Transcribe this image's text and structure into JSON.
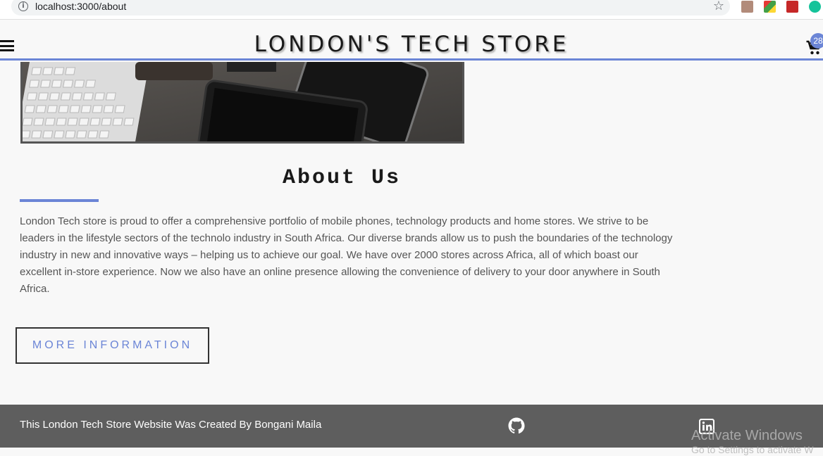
{
  "browser": {
    "url": "localhost:3000/about",
    "info_icon": "i"
  },
  "header": {
    "title": "LONDON'S TECH STORE",
    "cart_count": "28"
  },
  "about": {
    "title": "About Us",
    "body": "London Tech store is proud to offer a comprehensive portfolio of mobile phones, technology products and home stores. We strive to be leaders in the lifestyle sectors of the technolo industry in South Africa. Our diverse brands allow us to push the boundaries of the technology industry in new and innovative ways – helping us to achieve our goal. We have over 2000 stores across Africa, all of which boast our excellent in-store experience. Now we also have an online presence allowing the convenience of delivery to your door anywhere in South Africa.",
    "button_label": "MORE INFORMATION"
  },
  "footer": {
    "credit": "This London Tech Store Website Was Created By Bongani Maila"
  },
  "watermark": {
    "line1": "Activate Windows",
    "line2": "Go to Settings to activate W"
  },
  "colors": {
    "accent": "#6b85d6",
    "footer_bg": "#5e5e5e",
    "page_bg": "#f8f8f8"
  }
}
